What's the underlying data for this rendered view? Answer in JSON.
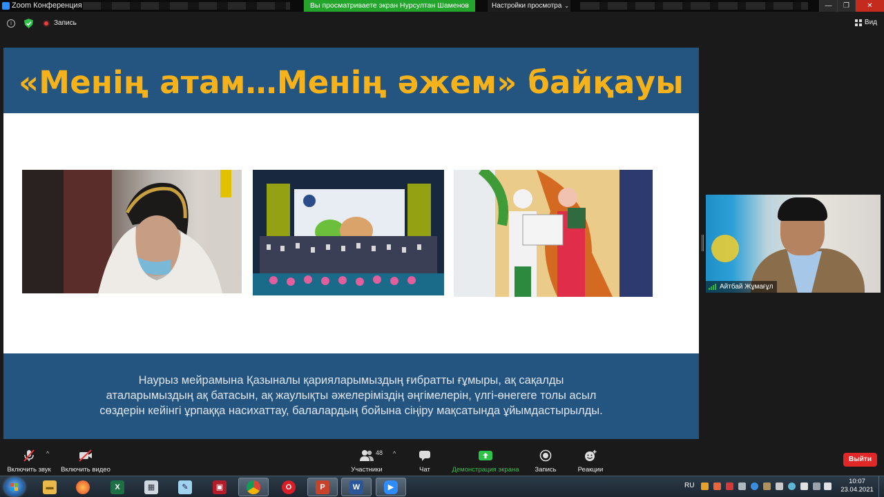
{
  "window": {
    "title": "Zoom Конференция",
    "share_banner": "Вы просматриваете экран Нурсултан Шаменов",
    "view_settings": "Настройки просмотра",
    "controls": [
      "—",
      "❐",
      "✕"
    ]
  },
  "topbar": {
    "record_label": "Запись",
    "view_label": "Вид"
  },
  "slide": {
    "title": "«Менің атам…Менің әжем» байқауы",
    "text_lines": [
      "Наурыз мейрамына Қазыналы қарияларымыздың ғибратты ғұмыры,  ақ сақалды",
      "аталарымыздың ақ батасын, ақ жаулықты әжелеріміздің әңгімелерін, үлгі-өнегеге толы асыл",
      "сөздерін кейінгі ұрпаққа насихаттау, балалардың бойына сіңіру мақсатында ұйымдастырылды."
    ],
    "colors": {
      "header_bg": "#245480",
      "title": "#f5b21b",
      "text": "#dfe6ee"
    }
  },
  "participant": {
    "name": "Айтбай Жұмағұл"
  },
  "toolbar": {
    "unmute": "Включить звук",
    "start_video": "Включить видео",
    "participants": "Участники",
    "participants_count": "48",
    "chat": "Чат",
    "share_screen": "Демонстрация экрана",
    "record": "Запись",
    "reactions": "Реакции",
    "end": "Выйти",
    "accent_green": "#2fc24a",
    "end_red": "#e02828"
  },
  "taskbar": {
    "apps": [
      {
        "name": "explorer",
        "glyph": "📁"
      },
      {
        "name": "firefox",
        "glyph": "🦊"
      },
      {
        "name": "excel",
        "glyph": "X"
      },
      {
        "name": "calculator",
        "glyph": "▦"
      },
      {
        "name": "notes",
        "glyph": "✎"
      },
      {
        "name": "app",
        "glyph": "▣"
      },
      {
        "name": "chrome",
        "glyph": "◉"
      },
      {
        "name": "opera",
        "glyph": "O"
      },
      {
        "name": "powerpoint",
        "glyph": "P"
      },
      {
        "name": "word",
        "glyph": "W"
      },
      {
        "name": "zoom",
        "glyph": "▶"
      }
    ],
    "language": "RU",
    "time": "10:07",
    "date": "23.04.2021"
  }
}
